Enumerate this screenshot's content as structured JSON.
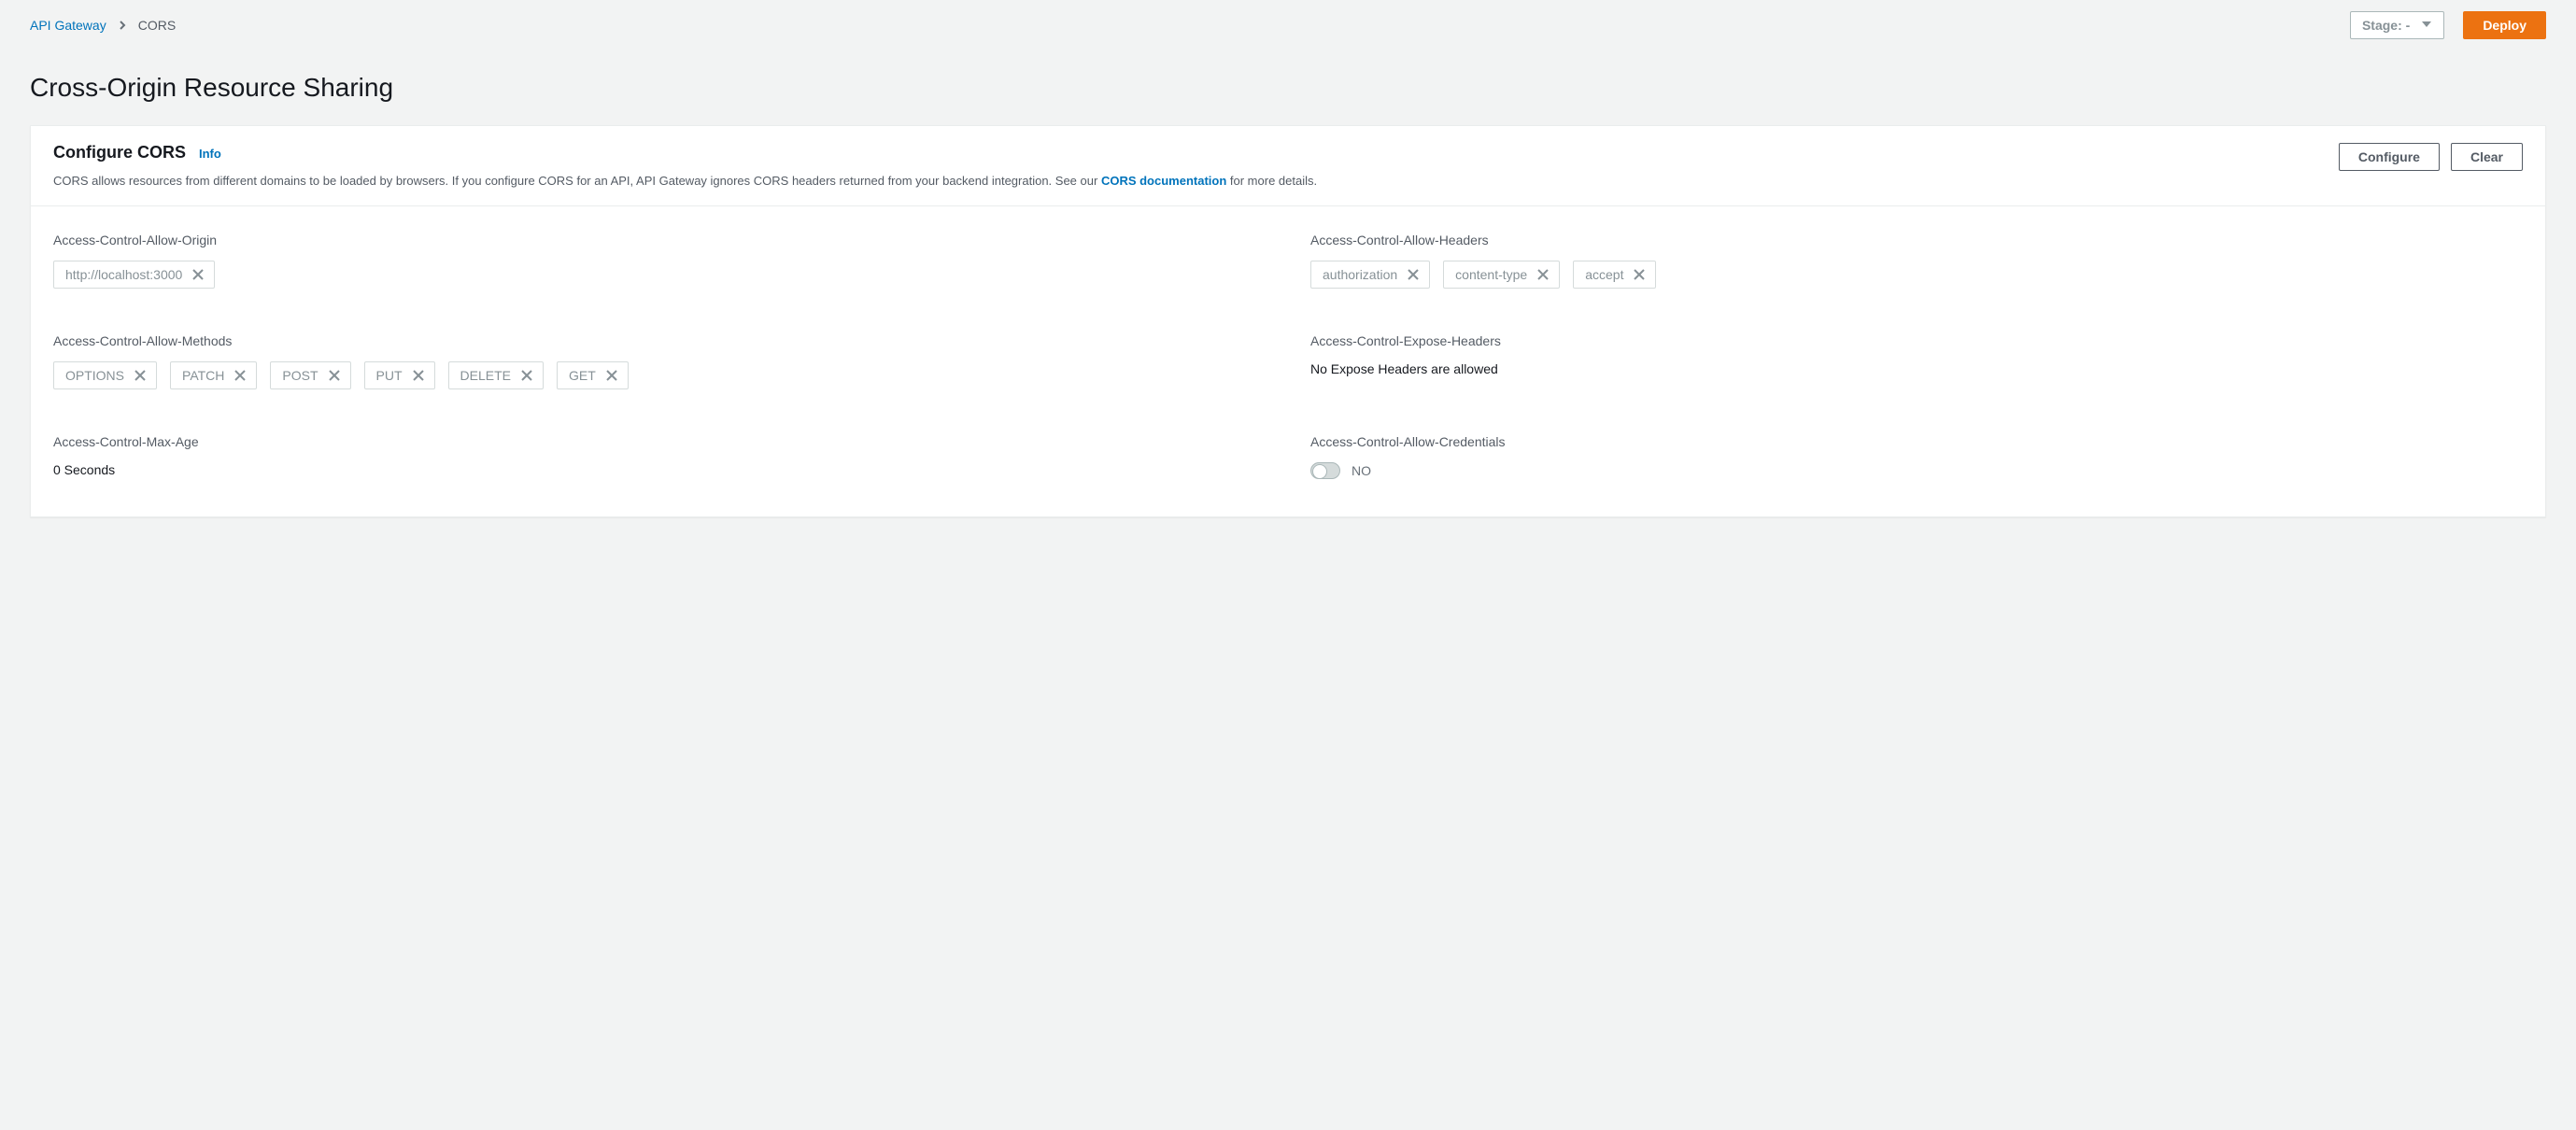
{
  "breadcrumbs": {
    "root": "API Gateway",
    "current": "CORS"
  },
  "topbar": {
    "stage_label": "Stage: -",
    "deploy_label": "Deploy"
  },
  "page_title": "Cross-Origin Resource Sharing",
  "panel": {
    "title": "Configure CORS",
    "info_label": "Info",
    "description_prefix": "CORS allows resources from different domains to be loaded by browsers. If you configure CORS for an API, API Gateway ignores CORS headers returned from your backend integration. See our ",
    "description_link": "CORS documentation",
    "description_suffix": " for more details.",
    "configure_label": "Configure",
    "clear_label": "Clear"
  },
  "fields": {
    "allow_origin": {
      "label": "Access-Control-Allow-Origin",
      "items": [
        "http://localhost:3000"
      ]
    },
    "allow_headers": {
      "label": "Access-Control-Allow-Headers",
      "items": [
        "authorization",
        "content-type",
        "accept"
      ]
    },
    "allow_methods": {
      "label": "Access-Control-Allow-Methods",
      "items": [
        "OPTIONS",
        "PATCH",
        "POST",
        "PUT",
        "DELETE",
        "GET"
      ]
    },
    "expose_headers": {
      "label": "Access-Control-Expose-Headers",
      "value": "No Expose Headers are allowed"
    },
    "max_age": {
      "label": "Access-Control-Max-Age",
      "value": "0 Seconds"
    },
    "allow_credentials": {
      "label": "Access-Control-Allow-Credentials",
      "value": "NO",
      "enabled": false
    }
  }
}
